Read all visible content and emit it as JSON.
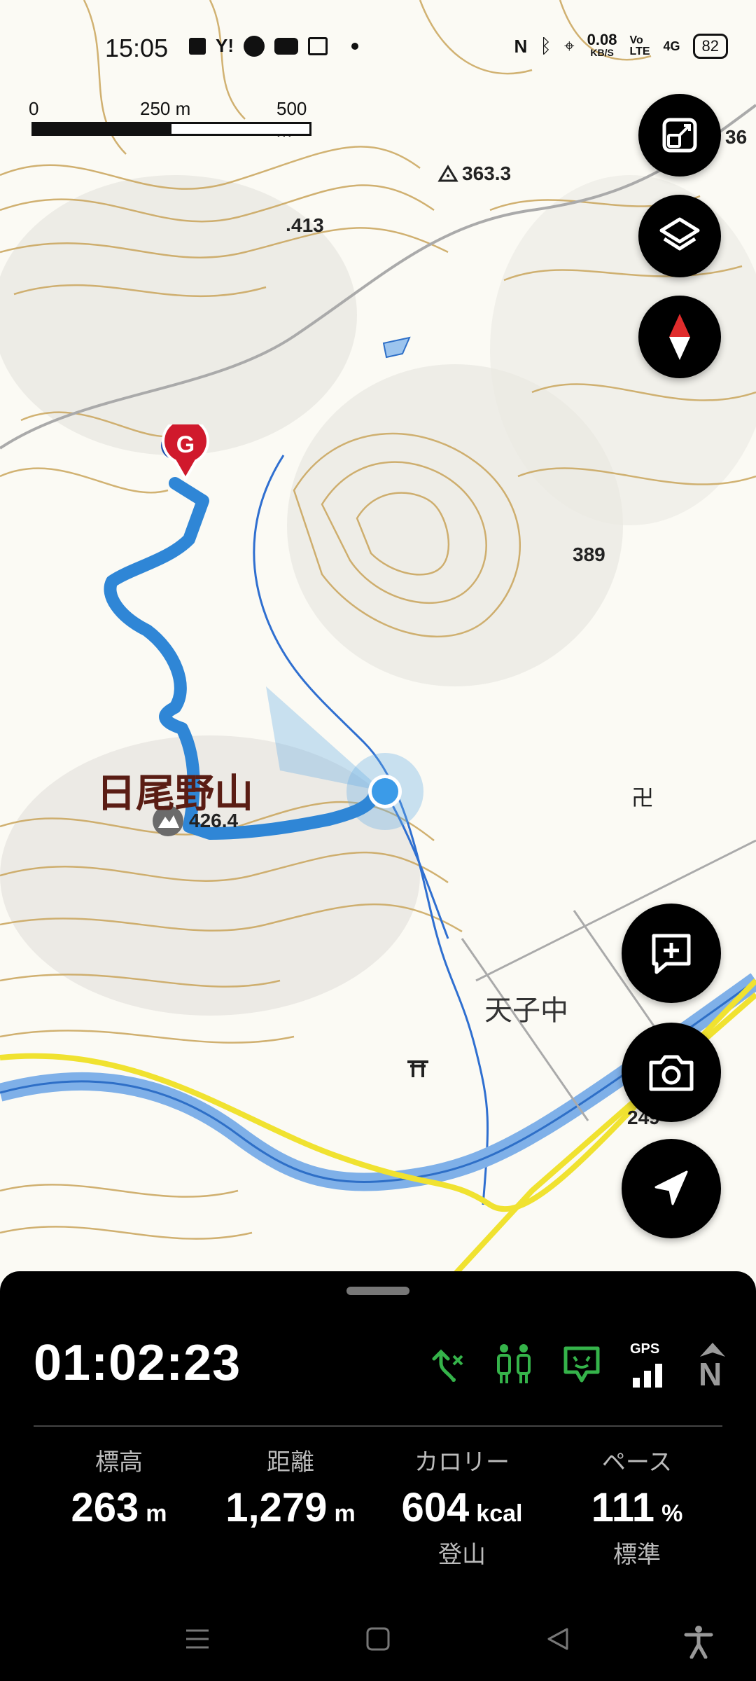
{
  "status_bar": {
    "time": "15:05",
    "network_speed": "0.08",
    "network_unit": "KB/S",
    "volte": "Vo LTE",
    "signal": "4G",
    "battery": "82",
    "icons": [
      "notification-icon",
      "yahoo-icon",
      "app-icon",
      "youtube-icon",
      "news-icon",
      "dot-icon",
      "nfc-icon",
      "bluetooth-icon",
      "location-icon"
    ]
  },
  "scale": {
    "min": "0",
    "mid": "250 m",
    "max": "500 m"
  },
  "map": {
    "labels": {
      "elev_363": "363.3",
      "elev_413": "413",
      "elev_389": "389",
      "elev_36": "36",
      "elev_249": "249",
      "elev_426": "426.4",
      "mountain": "日尾野山",
      "village": "天子中"
    },
    "goal_marker": "G",
    "route_color": "#2f86d6",
    "position_color": "#3b9be8"
  },
  "buttons": {
    "fit": "fit-screen-icon",
    "layers": "layers-icon",
    "compass": "compass-icon",
    "add_memo": "add-memo-icon",
    "camera": "camera-icon",
    "locate": "navigation-arrow-icon"
  },
  "panel": {
    "timer": "01:02:23",
    "status_icons": [
      "route-off-icon",
      "hikers-icon",
      "chat-icon",
      "gps-signal-icon",
      "north-up-icon"
    ],
    "gps_label": "GPS",
    "north_label": "N",
    "stats": [
      {
        "label": "標高",
        "value": "263",
        "unit": "m",
        "sub": ""
      },
      {
        "label": "距離",
        "value": "1,279",
        "unit": "m",
        "sub": ""
      },
      {
        "label": "カロリー",
        "value": "604",
        "unit": "kcal",
        "sub": "登山"
      },
      {
        "label": "ペース",
        "value": "111",
        "unit": "%",
        "sub": "標準"
      }
    ]
  }
}
